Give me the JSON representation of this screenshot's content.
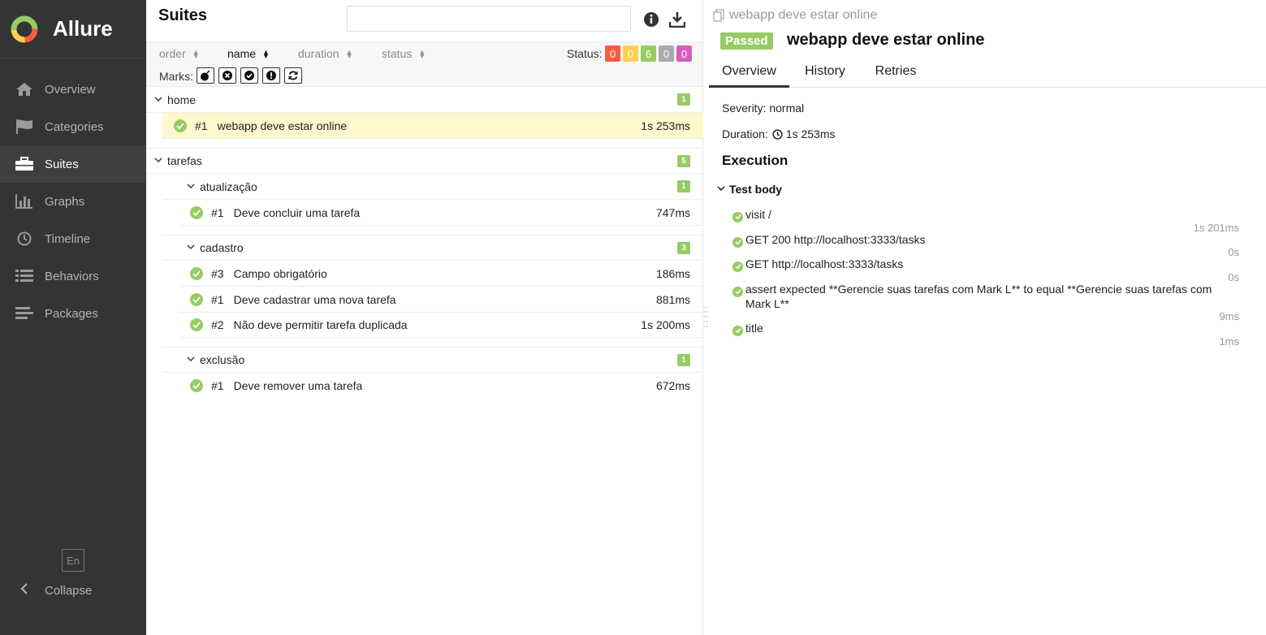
{
  "brand": {
    "name": "Allure"
  },
  "sidebar": {
    "items": [
      {
        "label": "Overview",
        "icon": "home-icon"
      },
      {
        "label": "Categories",
        "icon": "flag-icon"
      },
      {
        "label": "Suites",
        "icon": "briefcase-icon",
        "active": true
      },
      {
        "label": "Graphs",
        "icon": "bar-chart-icon"
      },
      {
        "label": "Timeline",
        "icon": "clock-icon"
      },
      {
        "label": "Behaviors",
        "icon": "list-icon"
      },
      {
        "label": "Packages",
        "icon": "align-left-icon"
      }
    ],
    "language": "En",
    "collapse_label": "Collapse"
  },
  "tree": {
    "title": "Suites",
    "search_placeholder": "",
    "sorters": [
      "order",
      "name",
      "duration",
      "status"
    ],
    "active_sorter": "name",
    "status_label": "Status:",
    "status_counts": [
      {
        "value": "0",
        "color": "#fd5a3e"
      },
      {
        "value": "0",
        "color": "#ffd050"
      },
      {
        "value": "6",
        "color": "#97cc64"
      },
      {
        "value": "0",
        "color": "#aaaaaa"
      },
      {
        "value": "0",
        "color": "#d35ebe"
      }
    ],
    "marks_label": "Marks:",
    "groups": {
      "home": {
        "name": "home",
        "count": "1"
      },
      "tarefas": {
        "name": "tarefas",
        "count": "5"
      },
      "atualizacao": {
        "name": "atualização",
        "count": "1"
      },
      "cadastro": {
        "name": "cadastro",
        "count": "3"
      },
      "exclusao": {
        "name": "exclusão",
        "count": "1"
      }
    },
    "rows": {
      "home_1": {
        "idx": "#1",
        "name": "webapp deve estar online",
        "dur": "1s 253ms"
      },
      "atual_1": {
        "idx": "#1",
        "name": "Deve concluir uma tarefa",
        "dur": "747ms"
      },
      "cad_3": {
        "idx": "#3",
        "name": "Campo obrigatório",
        "dur": "186ms"
      },
      "cad_1": {
        "idx": "#1",
        "name": "Deve cadastrar uma nova tarefa",
        "dur": "881ms"
      },
      "cad_2": {
        "idx": "#2",
        "name": "Não deve permitir tarefa duplicada",
        "dur": "1s 200ms"
      },
      "excl_1": {
        "idx": "#1",
        "name": "Deve remover uma tarefa",
        "dur": "672ms"
      }
    }
  },
  "detail": {
    "breadcrumb": "webapp deve estar online",
    "status": "Passed",
    "title": "webapp deve estar online",
    "tabs": [
      "Overview",
      "History",
      "Retries"
    ],
    "severity": "Severity: normal",
    "duration_label": "Duration:",
    "duration_value": "1s 253ms",
    "execution_title": "Execution",
    "test_body": "Test body",
    "steps": [
      {
        "text": "visit /",
        "dur": "1s 201ms"
      },
      {
        "text": "GET 200 http://localhost:3333/tasks",
        "dur": "0s"
      },
      {
        "text": "GET http://localhost:3333/tasks",
        "dur": "0s"
      },
      {
        "text": "assert expected **Gerencie suas tarefas com Mark L** to equal **Gerencie suas tarefas com Mark L**",
        "dur": "9ms"
      },
      {
        "text": "title",
        "dur": "1ms"
      }
    ]
  },
  "colors": {
    "passed": "#97cc64",
    "sidebar": "#343434",
    "selected_row": "#fff8cc"
  }
}
